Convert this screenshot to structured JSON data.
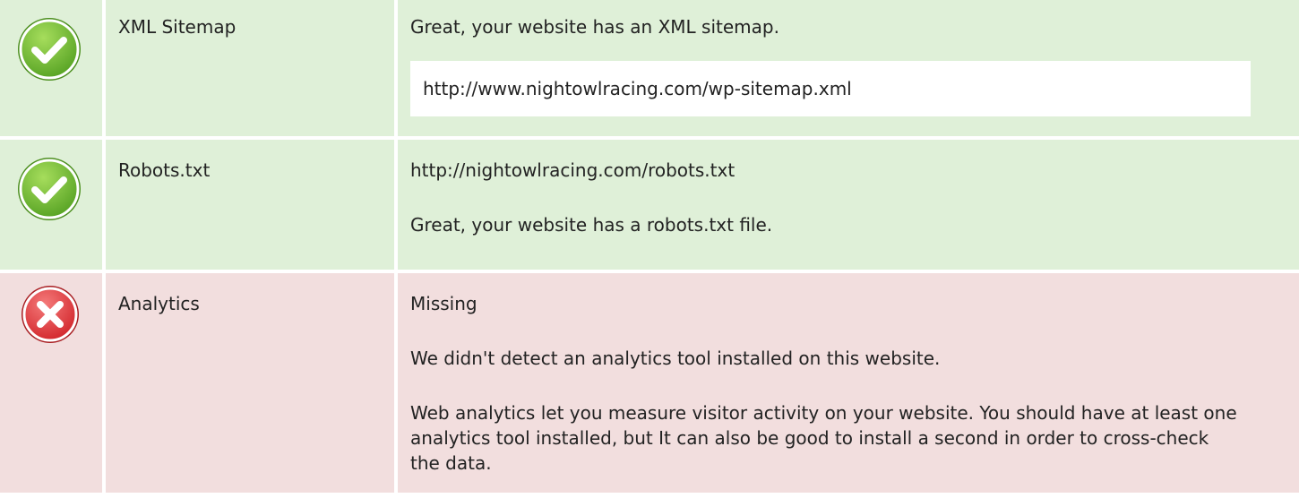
{
  "rows": [
    {
      "status": "ok",
      "icon": "checkmark-icon",
      "label": "XML Sitemap",
      "message": "Great, your website has an XML sitemap.",
      "url": "http://www.nightowlracing.com/wp-sitemap.xml"
    },
    {
      "status": "ok",
      "icon": "checkmark-icon",
      "label": "Robots.txt",
      "url": "http://nightowlracing.com/robots.txt",
      "message": "Great, your website has a robots.txt file."
    },
    {
      "status": "fail",
      "icon": "cross-icon",
      "label": "Analytics",
      "result": "Missing",
      "message": "We didn't detect an analytics tool installed on this website.",
      "explanation": "Web analytics let you measure visitor activity on your website. You should have at least one analytics tool installed, but It can also be good to install a second in order to cross-check the data."
    }
  ],
  "colors": {
    "ok_row": "#dff0d8",
    "fail_row": "#f2dede",
    "ok_icon": "#7cc33b",
    "fail_icon": "#e0383e"
  }
}
